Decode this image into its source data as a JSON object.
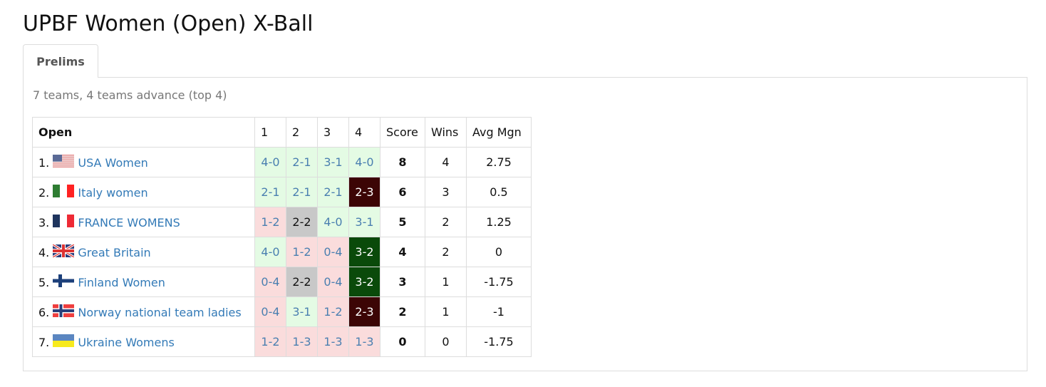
{
  "page": {
    "title": "UPBF Women (Open) X-Ball"
  },
  "tabs": [
    {
      "label": "Prelims",
      "active": true
    }
  ],
  "panel": {
    "subtitle": "7 teams, 4 teams advance (top 4)"
  },
  "table": {
    "headers": {
      "group": "Open",
      "rounds": [
        "1",
        "2",
        "3",
        "4"
      ],
      "score": "Score",
      "wins": "Wins",
      "avg": "Avg Mgn"
    },
    "rows": [
      {
        "rank": "1.",
        "flag": "usa-flag-icon",
        "team": "USA Women",
        "results": [
          {
            "v": "4-0",
            "type": "win"
          },
          {
            "v": "2-1",
            "type": "win"
          },
          {
            "v": "3-1",
            "type": "win"
          },
          {
            "v": "4-0",
            "type": "win"
          }
        ],
        "score": "8",
        "wins": "4",
        "avg": "2.75"
      },
      {
        "rank": "2.",
        "flag": "italy-flag-icon",
        "team": "Italy women",
        "results": [
          {
            "v": "2-1",
            "type": "win"
          },
          {
            "v": "2-1",
            "type": "win"
          },
          {
            "v": "2-1",
            "type": "win"
          },
          {
            "v": "2-3",
            "type": "decider-loss"
          }
        ],
        "score": "6",
        "wins": "3",
        "avg": "0.5"
      },
      {
        "rank": "3.",
        "flag": "france-flag-icon",
        "team": "FRANCE WOMENS",
        "results": [
          {
            "v": "1-2",
            "type": "loss"
          },
          {
            "v": "2-2",
            "type": "draw"
          },
          {
            "v": "4-0",
            "type": "win"
          },
          {
            "v": "3-1",
            "type": "win"
          }
        ],
        "score": "5",
        "wins": "2",
        "avg": "1.25"
      },
      {
        "rank": "4.",
        "flag": "great-britain-flag-icon",
        "team": "Great Britain",
        "results": [
          {
            "v": "4-0",
            "type": "win"
          },
          {
            "v": "1-2",
            "type": "loss"
          },
          {
            "v": "0-4",
            "type": "loss"
          },
          {
            "v": "3-2",
            "type": "decider-win"
          }
        ],
        "score": "4",
        "wins": "2",
        "avg": "0"
      },
      {
        "rank": "5.",
        "flag": "finland-flag-icon",
        "team": "Finland Women",
        "results": [
          {
            "v": "0-4",
            "type": "loss"
          },
          {
            "v": "2-2",
            "type": "draw"
          },
          {
            "v": "0-4",
            "type": "loss"
          },
          {
            "v": "3-2",
            "type": "decider-win"
          }
        ],
        "score": "3",
        "wins": "1",
        "avg": "-1.75"
      },
      {
        "rank": "6.",
        "flag": "norway-flag-icon",
        "team": "Norway national team ladies",
        "results": [
          {
            "v": "0-4",
            "type": "loss"
          },
          {
            "v": "3-1",
            "type": "win"
          },
          {
            "v": "1-2",
            "type": "loss"
          },
          {
            "v": "2-3",
            "type": "decider-loss"
          }
        ],
        "score": "2",
        "wins": "1",
        "avg": "-1"
      },
      {
        "rank": "7.",
        "flag": "ukraine-flag-icon",
        "team": "Ukraine Womens",
        "results": [
          {
            "v": "1-2",
            "type": "loss"
          },
          {
            "v": "1-3",
            "type": "loss"
          },
          {
            "v": "1-3",
            "type": "loss"
          },
          {
            "v": "1-3",
            "type": "loss"
          }
        ],
        "score": "0",
        "wins": "0",
        "avg": "-1.75"
      }
    ]
  },
  "colors": {
    "link": "#337ab7",
    "win_bg": "#e4fbe4",
    "loss_bg": "#fadcdc",
    "draw_bg": "#c8c8c8",
    "decider_win_bg": "#0a4a0a",
    "decider_loss_bg": "#3c0505"
  }
}
